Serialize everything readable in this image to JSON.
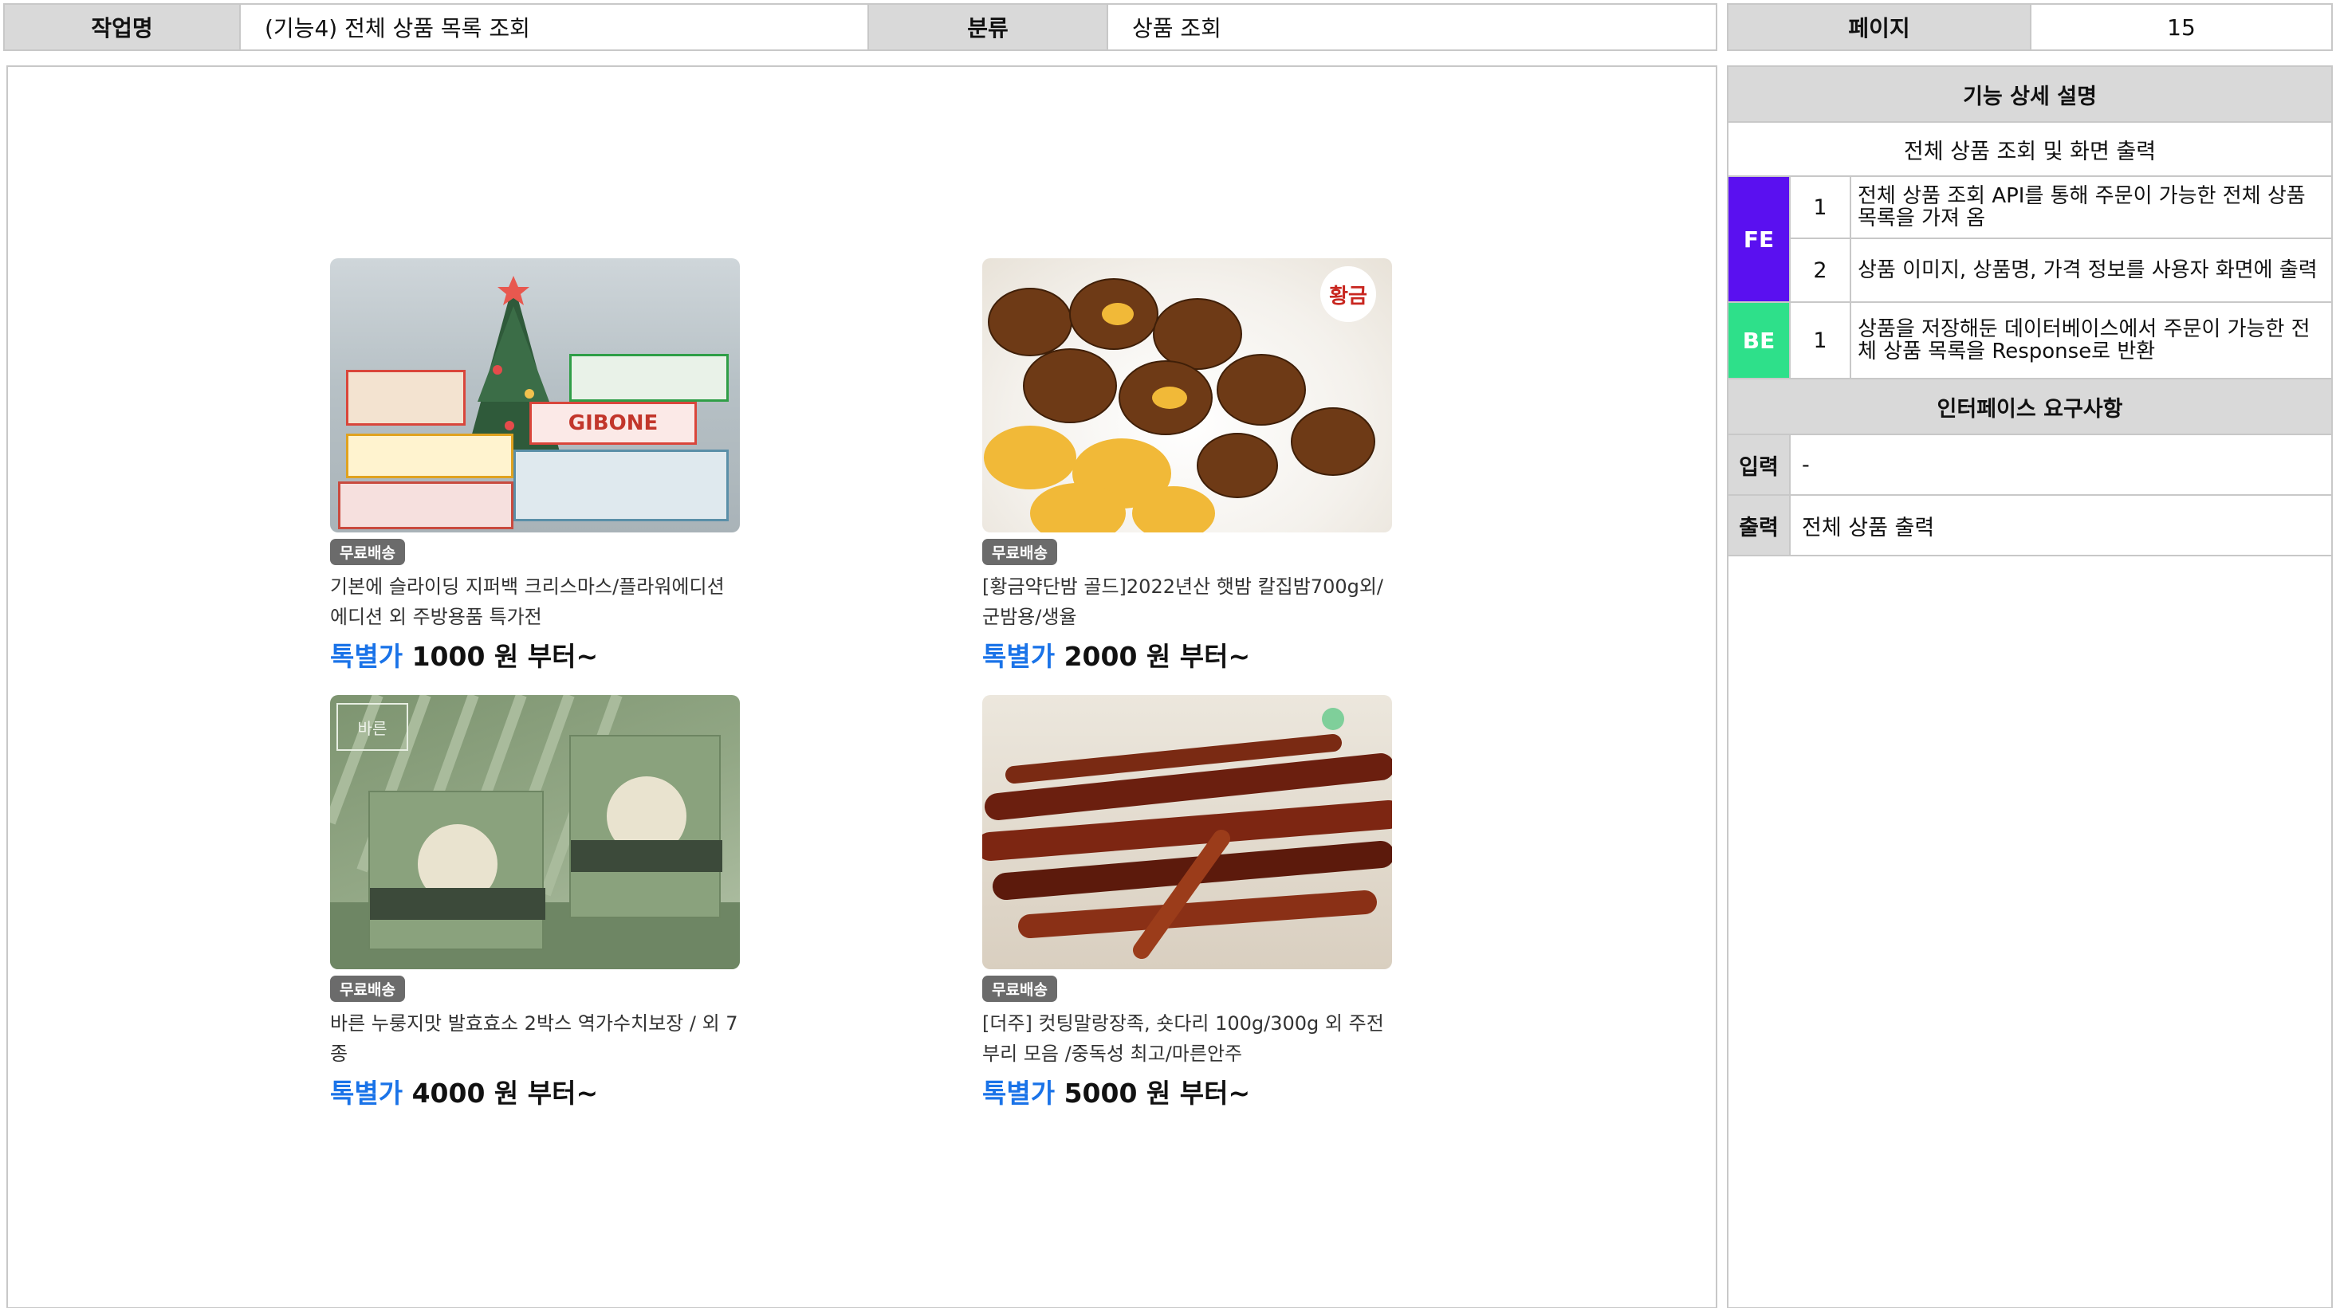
{
  "header": {
    "task_label": "작업명",
    "task_value": "(기능4) 전체 상품 목록 조회",
    "category_label": "분류",
    "category_value": "상품 조회",
    "page_label": "페이지",
    "page_value": "15"
  },
  "products": [
    {
      "badge": "무료배송",
      "name": "기본에 슬라이딩 지퍼백 크리스마스/플라워에디션 에디션 외 주방용품 특가전",
      "price_tag": "톡별가",
      "price": "1000 원 부터~",
      "image_label": "GIBONE"
    },
    {
      "badge": "무료배송",
      "name": "[황금약단밤 골드]2022년산 햇밤 칼집밤700g외/군밤용/생율",
      "price_tag": "톡별가",
      "price": "2000 원 부터~",
      "image_label": "황금"
    },
    {
      "badge": "무료배송",
      "name": "바른 누룽지맛 발효효소 2박스 역가수치보장 / 외 7종",
      "price_tag": "톡별가",
      "price": "4000 원 부터~",
      "image_label": "바른"
    },
    {
      "badge": "무료배송",
      "name": "[더주] 컷팅말랑장족, 숏다리 100g/300g 외 주전부리 모음 /중독성 최고/마른안주",
      "price_tag": "톡별가",
      "price": "5000 원 부터~",
      "image_label": ""
    }
  ],
  "spec": {
    "detail_title": "기능 상세 설명",
    "detail_subtitle": "전체 상품 조회 및 화면 출력",
    "groups": [
      {
        "tag": "FE",
        "color": "#5a10f0",
        "items": [
          {
            "num": "1",
            "text": "전체 상품 조회 API를 통해 주문이 가능한 전체 상품 목록을 가져 옴"
          },
          {
            "num": "2",
            "text": "상품 이미지, 상품명, 가격 정보를 사용자 화면에 출력"
          }
        ]
      },
      {
        "tag": "BE",
        "color": "#2ee08a",
        "items": [
          {
            "num": "1",
            "text": "상품을 저장해둔 데이터베이스에서 주문이 가능한 전체 상품 목록을 Response로 반환"
          }
        ]
      }
    ],
    "interface_title": "인터페이스 요구사항",
    "input_label": "입력",
    "input_value": "-",
    "output_label": "출력",
    "output_value": "전체 상품 출력"
  }
}
